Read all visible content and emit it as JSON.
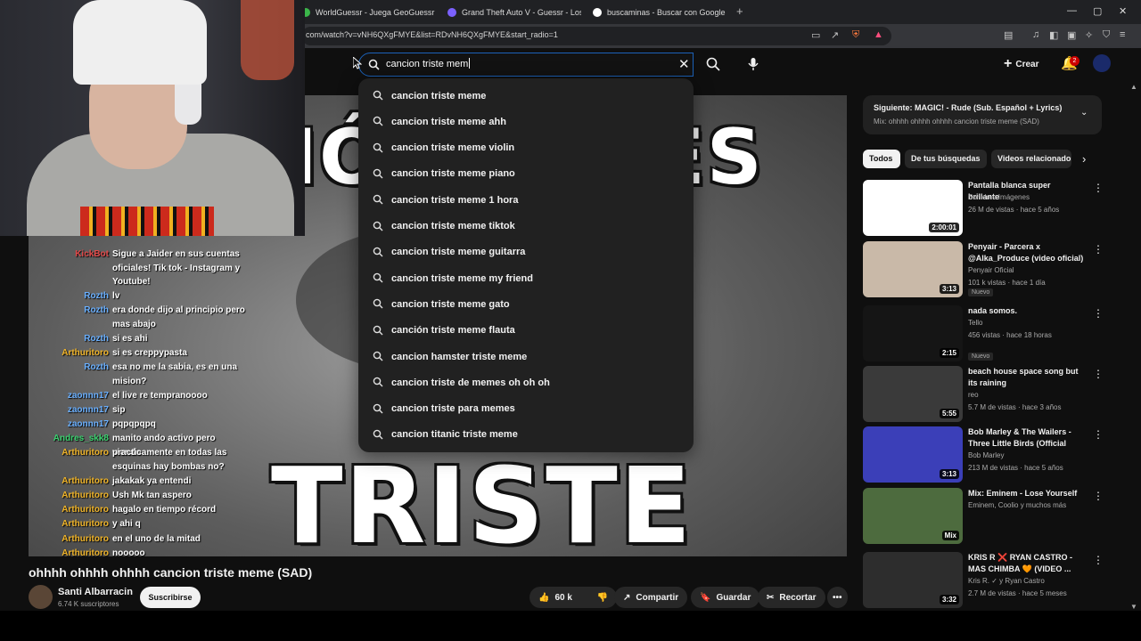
{
  "tabs": [
    {
      "label": "WorldGuessr - Juega GeoGuessr grat",
      "color": "#3bb54a"
    },
    {
      "label": "Grand Theft Auto V - Guessr - Lostga",
      "color": "#7b61ff"
    },
    {
      "label": "buscaminas - Buscar con Google",
      "color": "#ffffff"
    }
  ],
  "new_tab": "+",
  "url": "com/watch?v=vNH6QXgFMYE&list=RDvNH6QXgFMYE&start_radio=1",
  "header": {
    "search_value": "cancion triste mem",
    "create_label": "Crear",
    "notif_count": "2"
  },
  "suggestions": [
    "cancion triste meme",
    "cancion triste meme ahh",
    "cancion triste meme violin",
    "cancion triste meme piano",
    "cancion triste meme 1 hora",
    "cancion triste meme tiktok",
    "cancion triste meme guitarra",
    "cancion triste meme my friend",
    "cancion triste meme gato",
    "canción triste meme flauta",
    "cancion hamster triste meme",
    "cancion triste de memes oh oh oh",
    "cancion triste para memes",
    "cancion titanic triste meme"
  ],
  "video_overlay": {
    "word1": "IÓ",
    "word2": "ES",
    "word3": "TRISTE"
  },
  "chat": [
    {
      "user": "KickBot",
      "color": "#e24a4a",
      "text": "Sigue a Jaider en sus cuentas oficiales! Tik tok - Instagram y Youtube!",
      "lines": 3
    },
    {
      "user": "Rozth",
      "color": "#6ab0ff",
      "text": "lv",
      "lines": 1
    },
    {
      "user": "Rozth",
      "color": "#6ab0ff",
      "text": "era donde dijo al principio pero mas abajo",
      "lines": 2
    },
    {
      "user": "Rozth",
      "color": "#6ab0ff",
      "text": "si es ahi",
      "lines": 1
    },
    {
      "user": "Arthuritoro",
      "color": "#f0b429",
      "text": "si es creppypasta",
      "lines": 1
    },
    {
      "user": "Rozth",
      "color": "#6ab0ff",
      "text": "esa no me la sabia, es en una mision?",
      "lines": 2
    },
    {
      "user": "zaonnn17",
      "color": "#6ab0ff",
      "text": "el live re tempranoooo",
      "lines": 1
    },
    {
      "user": "zaonnn17",
      "color": "#6ab0ff",
      "text": "sip",
      "lines": 1
    },
    {
      "user": "zaonnn17",
      "color": "#6ab0ff",
      "text": "pqpqpqpq",
      "lines": 1
    },
    {
      "user": "Andres_skk8",
      "color": "#3bd16f",
      "text": "manito ando activo pero viendo",
      "lines": 1
    },
    {
      "user": "Arthuritoro",
      "color": "#f0b429",
      "text": "practicamente en todas las esquinas hay bombas no?",
      "lines": 2
    },
    {
      "user": "Arthuritoro",
      "color": "#f0b429",
      "text": "jakakak ya entendi",
      "lines": 1
    },
    {
      "user": "Arthuritoro",
      "color": "#f0b429",
      "text": "Ush Mk tan aspero",
      "lines": 1
    },
    {
      "user": "Arthuritoro",
      "color": "#f0b429",
      "text": "hagalo en tiempo récord",
      "lines": 1
    },
    {
      "user": "Arthuritoro",
      "color": "#f0b429",
      "text": "y ahi q",
      "lines": 1
    },
    {
      "user": "Arthuritoro",
      "color": "#f0b429",
      "text": "en el uno de la mitad",
      "lines": 1
    },
    {
      "user": "Arthuritoro",
      "color": "#f0b429",
      "text": "nooooo",
      "lines": 1
    }
  ],
  "video": {
    "title": "ohhhh ohhhh ohhhh cancion triste meme (SAD)",
    "channel": "Santi Albarracin",
    "subscribers": "6.74 K suscriptores",
    "subscribe_label": "Suscribirse",
    "likes": "60 k",
    "share_label": "Compartir",
    "save_label": "Guardar",
    "clip_label": "Recortar"
  },
  "sidebar": {
    "next_title": "Siguiente: MAGIC! - Rude (Sub. Español + Lyrics)",
    "next_sub": "Mix: ohhhh ohhhh ohhhh cancion triste meme (SAD)",
    "chips": [
      "Todos",
      "De tus búsquedas",
      "Videos relacionados"
    ],
    "videos": [
      {
        "title": "Pantalla blanca super brillante",
        "channel": "Sonido e Imágenes",
        "meta": "26 M de vistas · hace 5 años",
        "duration": "2:00:01",
        "thumb": "#ffffff",
        "new": "",
        "verified": false
      },
      {
        "title": "Penyair - Parcera x @Alka_Produce (video oficial)",
        "channel": "Penyair Oficial",
        "meta": "101 k vistas · hace 1 día",
        "duration": "3:13",
        "thumb": "#c9b9a8",
        "new": "Nuevo",
        "verified": true
      },
      {
        "title": "nada somos.",
        "channel": "Tello",
        "meta": "456 vistas · hace 18 horas",
        "duration": "2:15",
        "thumb": "#151515",
        "new": "Nuevo",
        "verified": true
      },
      {
        "title": "beach house space song but its raining",
        "channel": "reo",
        "meta": "5.7 M de vistas · hace 3 años",
        "duration": "5:55",
        "thumb": "#3a3a3a",
        "new": "",
        "verified": false
      },
      {
        "title": "Bob Marley & The Wailers - Three Little Birds (Official Mus...",
        "channel": "Bob Marley",
        "meta": "213 M de vistas · hace 5 años",
        "duration": "3:13",
        "thumb": "#3b3fb8",
        "new": "",
        "verified": true
      },
      {
        "title": "Mix: Eminem - Lose Yourself",
        "channel": "Eminem, Coolio y muchos más",
        "meta": "",
        "duration": "Mix",
        "thumb": "#4d6b3e",
        "new": "",
        "verified": false
      },
      {
        "title": "KRIS R ❌ RYAN CASTRO - MAS CHIMBA 🧡 (VIDEO ...",
        "channel": "Kris R. ✓ y Ryan Castro",
        "meta": "2.7 M de vistas · hace 5 meses",
        "duration": "3:32",
        "thumb": "#2d2d2d",
        "new": "",
        "verified": true
      }
    ]
  }
}
